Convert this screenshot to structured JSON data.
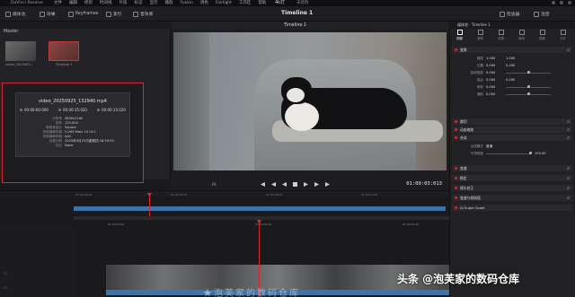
{
  "titlebar": {
    "app": "DaVinci Resolve",
    "menus": [
      "文件",
      "编辑",
      "修剪",
      "时间线",
      "片段",
      "标记",
      "显示",
      "播放",
      "Fusion",
      "调色",
      "Fairlight",
      "工作区",
      "帮助"
    ],
    "project": "4k灯",
    "status": "未修改"
  },
  "toolbar": {
    "media_pool": "媒体池",
    "effects": "效果",
    "keyframes": "Keyframes",
    "index": "索引",
    "sound_library": "音效库",
    "timeline_name": "Timeline 1",
    "inspector": "检查器",
    "mixer": "混音"
  },
  "left": {
    "master": "Master",
    "clips": [
      {
        "label": "video_2025092..."
      },
      {
        "label": "Timeline 1"
      }
    ],
    "info": {
      "filename": "video_20250925_132940.mp4",
      "timecodes": [
        "00:00:00:000",
        "00:00:15:020",
        "00:00:15:020"
      ],
      "meta": [
        {
          "k": "分辨率",
          "v": "3840x2160"
        },
        {
          "k": "帧率",
          "v": "120.000"
        },
        {
          "k": "像素宽高比",
          "v": "Square"
        },
        {
          "k": "视频编解码器",
          "v": "H.265 Main 10 L6.1"
        },
        {
          "k": "音频编解码器",
          "v": "AAC"
        },
        {
          "k": "创建日期",
          "v": "2025年9月25日星期四 18:29:55"
        },
        {
          "k": "标志",
          "v": "None"
        }
      ]
    }
  },
  "viewer": {
    "title": "Timeline 1",
    "timecode": "01:00:03:013",
    "zoom": "Fit"
  },
  "inspector": {
    "header": "媒体池 · Timeline 1",
    "tabs": [
      "视频",
      "音频",
      "效果",
      "转场",
      "图像",
      "文件"
    ],
    "sections": [
      "变换",
      "裁切",
      "动态缩放",
      "合成",
      "变速",
      "稳定",
      "镜头校正",
      "变速与帧插值",
      "AI Super Scale"
    ],
    "props": [
      {
        "k": "缩放",
        "v": "1.000"
      },
      {
        "k": "位置",
        "v": "0.000"
      },
      {
        "k": "旋转角度",
        "v": "0.000"
      },
      {
        "k": "锚点",
        "v": "0.000"
      },
      {
        "k": "俯仰",
        "v": "0.000"
      },
      {
        "k": "偏航",
        "v": "0.000"
      }
    ],
    "composite_mode": "普通",
    "opacity": "100.00"
  },
  "timeline": {
    "ruler_top": [
      "01:00:00:00",
      "01:00:04:00",
      "01:00:08:00",
      "01:00:12:00"
    ],
    "ruler_main": [
      "01:00:00:00",
      "01:00:02:10",
      "01:00:04:20"
    ],
    "tracks": [
      "V1",
      "A1"
    ],
    "subtitle": "★泡芙家的数码仓库"
  },
  "watermark": "头条 @泡芙家的数码仓库"
}
